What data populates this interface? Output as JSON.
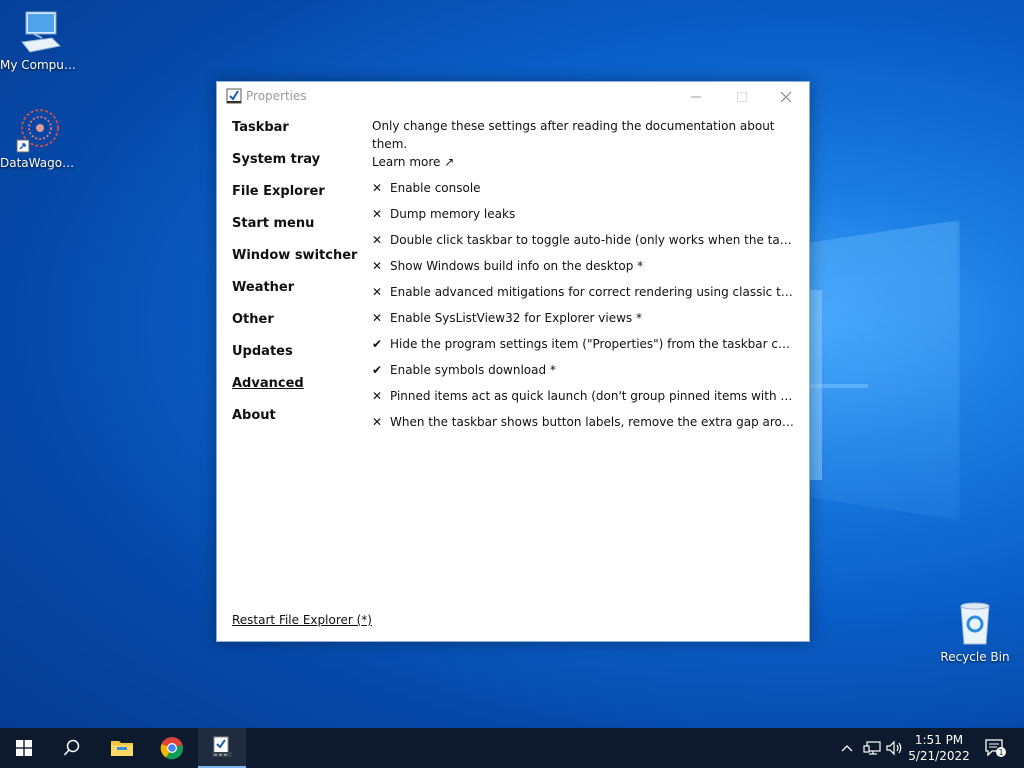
{
  "desktop": {
    "icons": [
      {
        "label": "My Computer"
      },
      {
        "label": "DataWagon..."
      },
      {
        "label": "Recycle Bin"
      }
    ]
  },
  "window": {
    "title": "Properties",
    "nav": [
      {
        "label": "Taskbar"
      },
      {
        "label": "System tray"
      },
      {
        "label": "File Explorer"
      },
      {
        "label": "Start menu"
      },
      {
        "label": "Window switcher"
      },
      {
        "label": "Weather"
      },
      {
        "label": "Other"
      },
      {
        "label": "Updates"
      },
      {
        "label": "Advanced",
        "active": true
      },
      {
        "label": "About"
      }
    ],
    "description": "Only change these settings after reading the documentation about them.",
    "learn_more": "Learn more ↗",
    "options": [
      {
        "mark": "✕",
        "label": "Enable console"
      },
      {
        "mark": "✕",
        "label": "Dump memory leaks"
      },
      {
        "mark": "✕",
        "label": "Double click taskbar to toggle auto-hide (only works when the taskbar is lo..."
      },
      {
        "mark": "✕",
        "label": "Show Windows build info on the desktop *"
      },
      {
        "mark": "✕",
        "label": "Enable advanced mitigations for correct rendering using classic theme *"
      },
      {
        "mark": "✕",
        "label": "Enable SysListView32 for Explorer views *"
      },
      {
        "mark": "✔",
        "label": "Hide the program settings item (\"Properties\") from the taskbar context me..."
      },
      {
        "mark": "✔",
        "label": "Enable symbols download *"
      },
      {
        "mark": "✕",
        "label": "Pinned items act as quick launch (don't group pinned items with active ap..."
      },
      {
        "mark": "✕",
        "label": "When the taskbar shows button labels, remove the extra gap around pinne..."
      }
    ],
    "restart_link": "Restart File Explorer (*)"
  },
  "taskbar": {
    "time": "1:51 PM",
    "date": "5/21/2022",
    "notification_count": "1",
    "items": [
      "start-icon",
      "search-icon",
      "file-explorer-icon",
      "chrome-icon",
      "properties-app-icon"
    ]
  }
}
